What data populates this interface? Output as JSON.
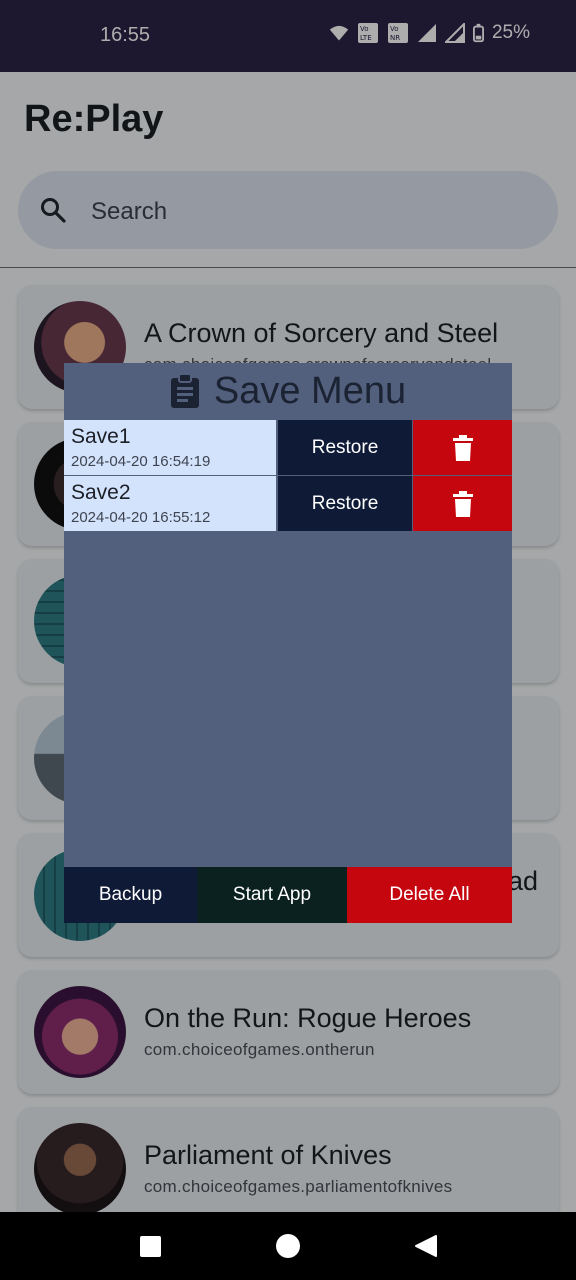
{
  "status_bar": {
    "time": "16:55",
    "battery": "25%",
    "icons": [
      "wifi-icon",
      "volte-lte-icon",
      "volte-nr-icon",
      "signal-icon",
      "signal-icon",
      "battery-icon"
    ],
    "volte1": "Vo LTE",
    "volte2": "Vo NR"
  },
  "app": {
    "title": "Re:Play",
    "search_placeholder": "Search"
  },
  "apps": [
    {
      "name": "A Crown of Sorcery and Steel",
      "package": "com.choiceofgames.crownofsorceryandsteel"
    },
    {
      "name": "",
      "package": ""
    },
    {
      "name": "",
      "package": ""
    },
    {
      "name": "",
      "package": ""
    },
    {
      "name": "ad",
      "package": ""
    },
    {
      "name": "On the Run: Rogue Heroes",
      "package": "com.choiceofgames.ontherun"
    },
    {
      "name": "Parliament of Knives",
      "package": "com.choiceofgames.parliamentofknives"
    }
  ],
  "save_menu": {
    "title": "Save Menu",
    "saves": [
      {
        "name": "Save1",
        "date": "2024-04-20 16:54:19",
        "restore_label": "Restore"
      },
      {
        "name": "Save2",
        "date": "2024-04-20 16:55:12",
        "restore_label": "Restore"
      }
    ],
    "backup_label": "Backup",
    "start_app_label": "Start App",
    "delete_all_label": "Delete All"
  },
  "colors": {
    "status_bar": "#2d2347",
    "modal_bg": "#52607e",
    "restore_bg": "#0f1a37",
    "delete_bg": "#c6060f",
    "save_row_bg": "#d4e3fc"
  }
}
